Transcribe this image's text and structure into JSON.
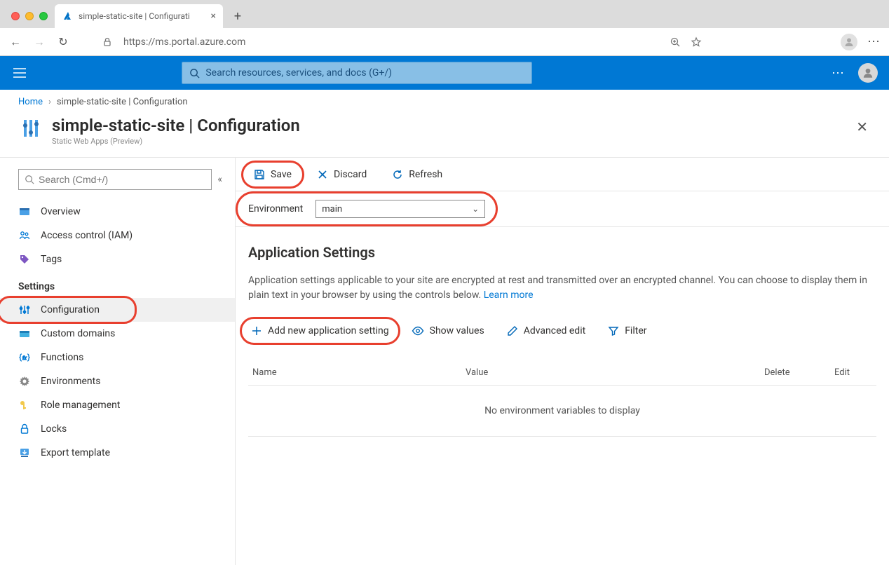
{
  "browser": {
    "tab_title": "simple-static-site | Configurati",
    "url": "https://ms.portal.azure.com"
  },
  "global_search_placeholder": "Search resources, services, and docs (G+/)",
  "breadcrumb": {
    "home": "Home",
    "current": "simple-static-site | Configuration"
  },
  "page": {
    "title": "simple-static-site | Configuration",
    "subtitle": "Static Web Apps (Preview)"
  },
  "sidebar": {
    "search_placeholder": "Search (Cmd+/)",
    "items_top": [
      {
        "label": "Overview"
      },
      {
        "label": "Access control (IAM)"
      },
      {
        "label": "Tags"
      }
    ],
    "section_label": "Settings",
    "items_settings": [
      {
        "label": "Configuration"
      },
      {
        "label": "Custom domains"
      },
      {
        "label": "Functions"
      },
      {
        "label": "Environments"
      },
      {
        "label": "Role management"
      },
      {
        "label": "Locks"
      },
      {
        "label": "Export template"
      }
    ]
  },
  "commands": {
    "save": "Save",
    "discard": "Discard",
    "refresh": "Refresh"
  },
  "environment": {
    "label": "Environment",
    "selected": "main"
  },
  "section": {
    "heading": "Application Settings",
    "description": "Application settings applicable to your site are encrypted at rest and transmitted over an encrypted channel. You can choose to display them in plain text in your browser by using the controls below. ",
    "learn_more": "Learn more"
  },
  "actions": {
    "add": "Add new application setting",
    "show": "Show values",
    "edit": "Advanced edit",
    "filter": "Filter"
  },
  "table": {
    "col_name": "Name",
    "col_value": "Value",
    "col_delete": "Delete",
    "col_edit": "Edit",
    "empty": "No environment variables to display"
  }
}
